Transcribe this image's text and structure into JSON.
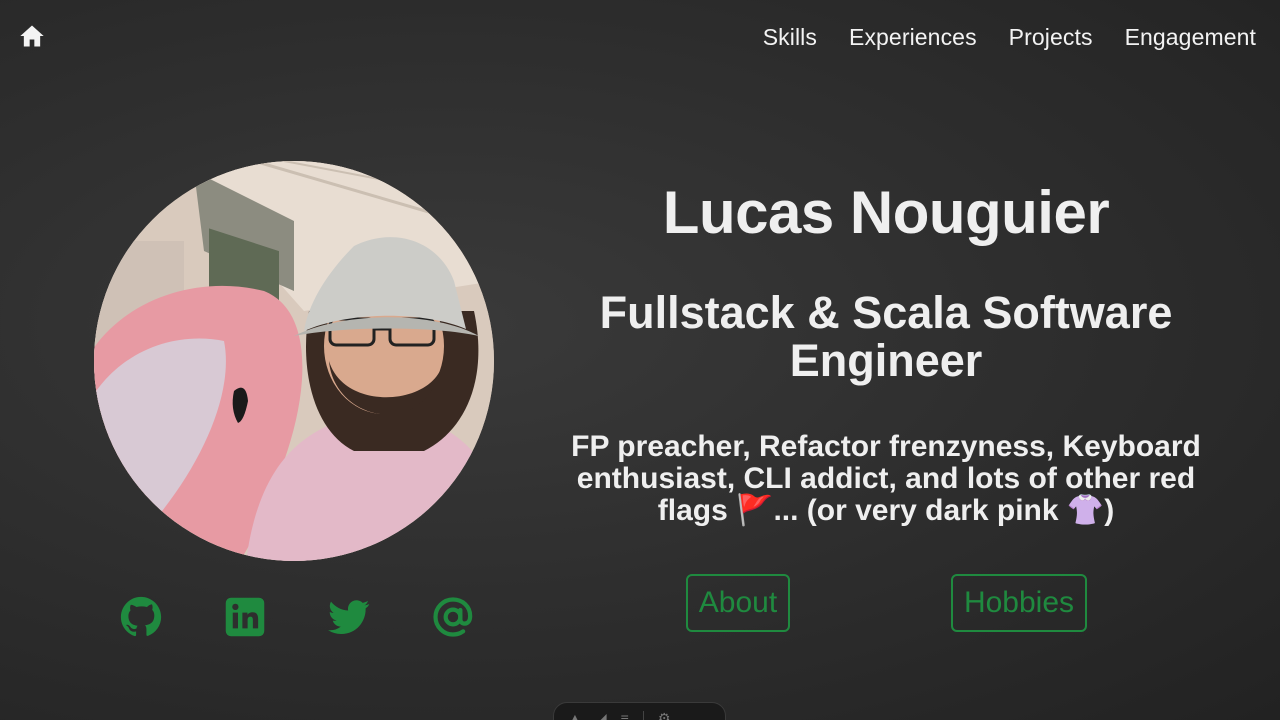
{
  "nav": {
    "home_icon": "home-icon",
    "items": [
      {
        "label": "Skills"
      },
      {
        "label": "Experiences"
      },
      {
        "label": "Projects"
      },
      {
        "label": "Engagement"
      }
    ]
  },
  "profile": {
    "name": "Lucas Nouguier",
    "role": "Fullstack & Scala Software Engineer",
    "tagline": "FP preacher, Refactor frenzyness, Keyboard enthusiast, CLI addict, and lots of other red flags 🚩... (or very dark pink 👚)",
    "photo_alt": "profile photo"
  },
  "socials": [
    {
      "icon": "github-icon"
    },
    {
      "icon": "linkedin-icon"
    },
    {
      "icon": "twitter-icon"
    },
    {
      "icon": "email-at-icon"
    }
  ],
  "buttons": {
    "about": "About",
    "hobbies": "Hobbies"
  },
  "colors": {
    "accent": "#1f8a3f",
    "text": "#efefef",
    "background": "#2e2e2e"
  }
}
